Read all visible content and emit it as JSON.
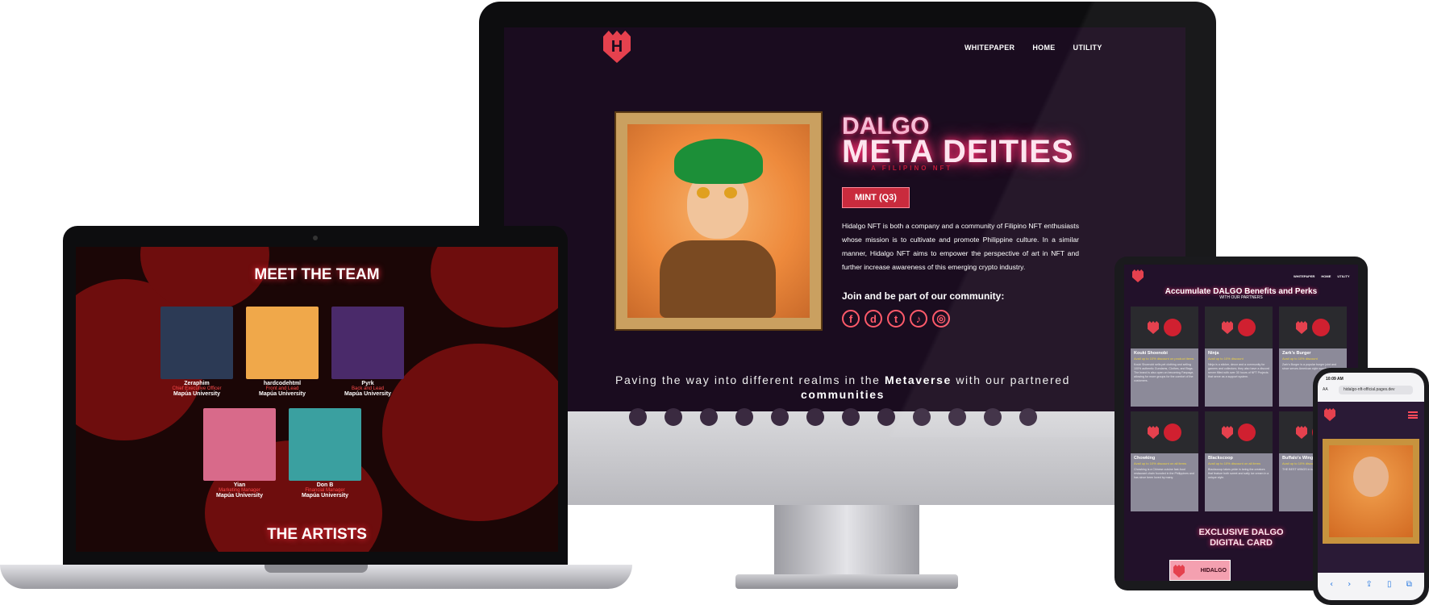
{
  "imac": {
    "nav": {
      "whitepaper": "WHITEPAPER",
      "home": "HOME",
      "utility": "UTILITY"
    },
    "logo_letter": "H",
    "title_top": "DALGO",
    "title_main": "META DEITIES",
    "title_sub": "A FILIPINO NFT",
    "mint_label": "MINT (Q3)",
    "description": "Hidalgo NFT is both a company and a community of Filipino NFT enthusiasts whose mission is to cultivate and promote Philippine culture. In a similar manner, Hidalgo NFT aims to empower the perspective of art in NFT and further increase awareness of this emerging crypto industry.",
    "join": "Join and be part of our community:",
    "socials": [
      {
        "name": "facebook-icon",
        "glyph": "f"
      },
      {
        "name": "discord-icon",
        "glyph": "d"
      },
      {
        "name": "twitter-icon",
        "glyph": "t"
      },
      {
        "name": "tiktok-icon",
        "glyph": "♪"
      },
      {
        "name": "instagram-icon",
        "glyph": "◎"
      }
    ],
    "paving_pre": "Paving the way into different realms in the ",
    "paving_bold1": "Metaverse",
    "paving_mid": " with our partnered ",
    "paving_bold2": "communities"
  },
  "laptop": {
    "heading": "MEET THE TEAM",
    "team": [
      {
        "name": "Zeraphim",
        "role": "Chief Executive Officer",
        "university": "Mapúa University",
        "color": "#2c3a55"
      },
      {
        "name": "hardcodehtml",
        "role": "Front and Lead",
        "university": "Mapúa University",
        "color": "#f0a84a"
      },
      {
        "name": "Pyrk",
        "role": "Back and Lead",
        "university": "Mapúa University",
        "color": "#4a2a6a"
      },
      {
        "name": "Yian",
        "role": "Marketing Manager",
        "university": "Mapúa University",
        "color": "#d86a8a"
      },
      {
        "name": "Don B",
        "role": "Financial Manager",
        "university": "Mapúa University",
        "color": "#3aa0a0"
      }
    ],
    "artists_heading": "THE ARTISTS"
  },
  "tablet": {
    "nav": {
      "whitepaper": "WHITEPAPER",
      "home": "HOME",
      "utility": "UTILITY"
    },
    "title": "Accumulate DALGO Benefits and Perks",
    "subtitle": "WITH OUR PARTNERS",
    "cards": [
      {
        "name": "Kouki Shoenobi",
        "highlight": "Avail up to 10% discount on product items",
        "text": "Kouki Shoenobi sells pet clothing and selling 100% authentic Gundams, Clothes, and Bags. The brand is also open on becoming Fanpage, allowing for more groups for the comfort of the customers."
      },
      {
        "name": "Ninja",
        "highlight": "Avail up to 10% discount",
        "text": "Ninja is a sticker, decor and a community for gamers and collectors; they also have a discord server filled with over 30 hours of NFT Projects that serve as a support system."
      },
      {
        "name": "Zark's Burger",
        "highlight": "Avail up to 10% discount",
        "text": "Zark's Burger is a popular burger joint and since serves American style wooden burgers."
      },
      {
        "name": "Chowking",
        "highlight": "Avail up to 10% discount on all items",
        "text": "Chowking is a Chinese cuisine fast-food restaurant chain founded in the Philippines and has since been loved by many."
      },
      {
        "name": "Blackscoop",
        "highlight": "Avail up to 10% discount on all items",
        "text": "Blackscoop takes pride in being the creators that feature both sweet and salty ice cream in a unique style."
      },
      {
        "name": "Buffalo's Wings",
        "highlight": "Avail up to 10% discount",
        "text": "THE BEST WINGS in town, a must for foodies."
      }
    ],
    "exclusive_line1": "EXCLUSIVE DALGO",
    "exclusive_line2": "DIGITAL CARD",
    "card_label": "HIDALGO"
  },
  "phone": {
    "time": "10:09 AM",
    "aa": "AA",
    "url": "hidalgo-nft-official.pages.dev"
  }
}
